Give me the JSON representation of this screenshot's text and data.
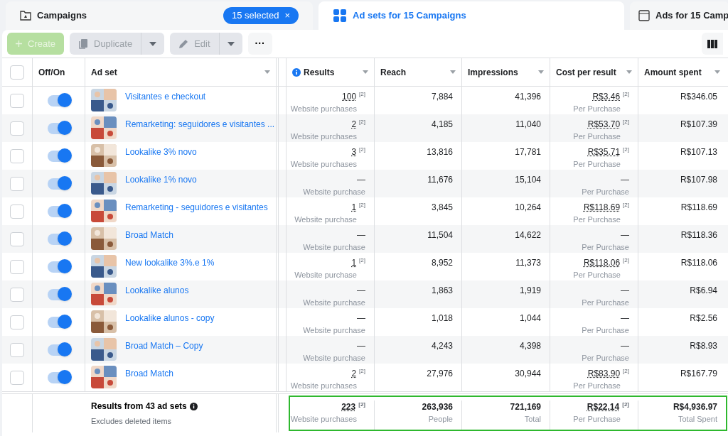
{
  "tabs": [
    {
      "kind": "campaigns",
      "label": "Campaigns",
      "badge": "15 selected",
      "badge_close": "×",
      "selected": false
    },
    {
      "kind": "adsets",
      "label": "Ad sets for 15 Campaigns",
      "selected": true
    },
    {
      "kind": "ads",
      "label": "Ads for 15 Camp",
      "selected": false
    }
  ],
  "toolbar": {
    "create": {
      "label": "Create",
      "disabled": true
    },
    "duplicate": {
      "label": "Duplicate",
      "disabled": true
    },
    "edit": {
      "label": "Edit",
      "disabled": true
    },
    "more": "···"
  },
  "select_all_checked": false,
  "columns": [
    "Off/On",
    "Ad set",
    "Results",
    "Reach",
    "Impressions",
    "Cost per result",
    "Amount spent"
  ],
  "rows": [
    {
      "name": "Visitantes e checkout",
      "checked": false,
      "on": true,
      "results": "100",
      "results_note": "[2]",
      "results_label": "Website purchases",
      "reach": "7,884",
      "impressions": "41,396",
      "cost": "R$3.46",
      "cost_note": "[2]",
      "cost_label": "Per Purchase",
      "spent": "R$346.05"
    },
    {
      "name": "Remarketing: seguidores e visitantes ...",
      "checked": false,
      "on": true,
      "results": "2",
      "results_note": "[2]",
      "results_label": "Website purchases",
      "reach": "4,185",
      "impressions": "11,040",
      "cost": "R$53.70",
      "cost_note": "[2]",
      "cost_label": "Per Purchase",
      "spent": "R$107.39"
    },
    {
      "name": "Lookalike 3% novo",
      "checked": false,
      "on": true,
      "results": "3",
      "results_note": "[2]",
      "results_label": "Website purchases",
      "reach": "13,816",
      "impressions": "17,781",
      "cost": "R$35.71",
      "cost_note": "[2]",
      "cost_label": "Per Purchase",
      "spent": "R$107.13"
    },
    {
      "name": "Lookalike 1% novo",
      "checked": false,
      "on": true,
      "results": "—",
      "results_label": "Website purchase",
      "reach": "11,676",
      "impressions": "15,104",
      "cost": "—",
      "cost_label": "Per Purchase",
      "spent": "R$107.98"
    },
    {
      "name": "Remarketing - seguidores e visitantes",
      "checked": false,
      "on": true,
      "results": "1",
      "results_note": "[2]",
      "results_label": "Website purchase",
      "reach": "3,845",
      "impressions": "10,264",
      "cost": "R$118.69",
      "cost_note": "[2]",
      "cost_label": "Per Purchase",
      "spent": "R$118.69"
    },
    {
      "name": "Broad Match",
      "checked": false,
      "on": true,
      "results": "—",
      "results_label": "Website purchase",
      "reach": "11,504",
      "impressions": "14,622",
      "cost": "—",
      "cost_label": "Per Purchase",
      "spent": "R$118.36"
    },
    {
      "name": "New lookalike 3%.e 1%",
      "checked": false,
      "on": true,
      "results": "1",
      "results_note": "[2]",
      "results_label": "Website purchase",
      "reach": "8,952",
      "impressions": "11,373",
      "cost": "R$118.06",
      "cost_note": "[2]",
      "cost_label": "Per Purchase",
      "spent": "R$118.06"
    },
    {
      "name": "Lookalike alunos",
      "checked": false,
      "on": true,
      "results": "—",
      "results_label": "Website purchase",
      "reach": "1,863",
      "impressions": "1,919",
      "cost": "—",
      "cost_label": "Per Purchase",
      "spent": "R$6.94"
    },
    {
      "name": "Lookalike alunos - copy",
      "checked": false,
      "on": true,
      "results": "—",
      "results_label": "Website purchase",
      "reach": "1,018",
      "impressions": "1,044",
      "cost": "—",
      "cost_label": "Per Purchase",
      "spent": "R$2.56"
    },
    {
      "name": "Broad Match – Copy",
      "checked": false,
      "on": true,
      "results": "—",
      "results_label": "Website purchase",
      "reach": "4,243",
      "impressions": "4,398",
      "cost": "—",
      "cost_label": "Per Purchase",
      "spent": "R$8.93"
    },
    {
      "name": "Broad Match",
      "checked": false,
      "on": true,
      "results": "2",
      "results_note": "[2]",
      "results_label": "Website purchases",
      "reach": "27,976",
      "impressions": "30,944",
      "cost": "R$83.90",
      "cost_note": "[2]",
      "cost_label": "Per Purchase",
      "spent": "R$167.79"
    }
  ],
  "totals": {
    "title": "Results from 43 ad sets",
    "subtitle": "Excludes deleted items",
    "results": "223",
    "results_note": "[2]",
    "results_label": "Website purchases",
    "reach": "263,936",
    "reach_label": "People",
    "impressions": "721,169",
    "impressions_label": "Total",
    "cost": "R$22.14",
    "cost_note": "[2]",
    "cost_label": "Per Purchase",
    "spent": "R$4,936.97",
    "spent_label": "Total Spent"
  }
}
